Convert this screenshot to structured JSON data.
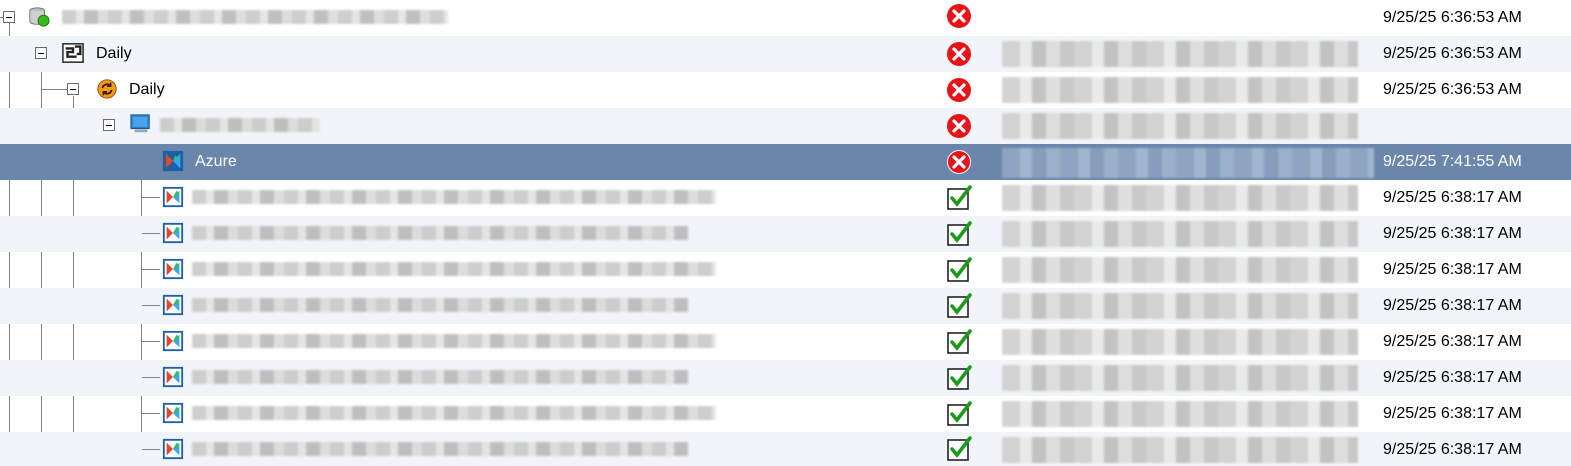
{
  "colors": {
    "selected_row": "#6a86ab",
    "alt_row": "#f1f4f8",
    "error_red": "#e8141c",
    "success_green": "#1a9a1a"
  },
  "icons": {
    "error": "error-x-circle-icon",
    "success": "success-checkmark-icon",
    "database": "database-icon",
    "schedule": "schedule-icon",
    "job": "job-refresh-icon",
    "computer": "computer-monitor-icon",
    "azure": "azure-target-icon",
    "item": "backup-item-icon"
  },
  "rows": [
    {
      "label": "",
      "status": "error",
      "time": "9/25/25 6:36:53 AM"
    },
    {
      "label": "Daily",
      "status": "error",
      "time": "9/25/25 6:36:53 AM"
    },
    {
      "label": "Daily",
      "status": "error",
      "time": "9/25/25 6:36:53 AM"
    },
    {
      "label": "",
      "status": "error",
      "time": ""
    },
    {
      "label": "Azure",
      "status": "error",
      "time": "9/25/25 7:41:55 AM"
    },
    {
      "label": "",
      "status": "success",
      "time": "9/25/25 6:38:17 AM"
    },
    {
      "label": "",
      "status": "success",
      "time": "9/25/25 6:38:17 AM"
    },
    {
      "label": "",
      "status": "success",
      "time": "9/25/25 6:38:17 AM"
    },
    {
      "label": "",
      "status": "success",
      "time": "9/25/25 6:38:17 AM"
    },
    {
      "label": "",
      "status": "success",
      "time": "9/25/25 6:38:17 AM"
    },
    {
      "label": "",
      "status": "success",
      "time": "9/25/25 6:38:17 AM"
    },
    {
      "label": "",
      "status": "success",
      "time": "9/25/25 6:38:17 AM"
    },
    {
      "label": "",
      "status": "success",
      "time": "9/25/25 6:38:17 AM"
    }
  ]
}
